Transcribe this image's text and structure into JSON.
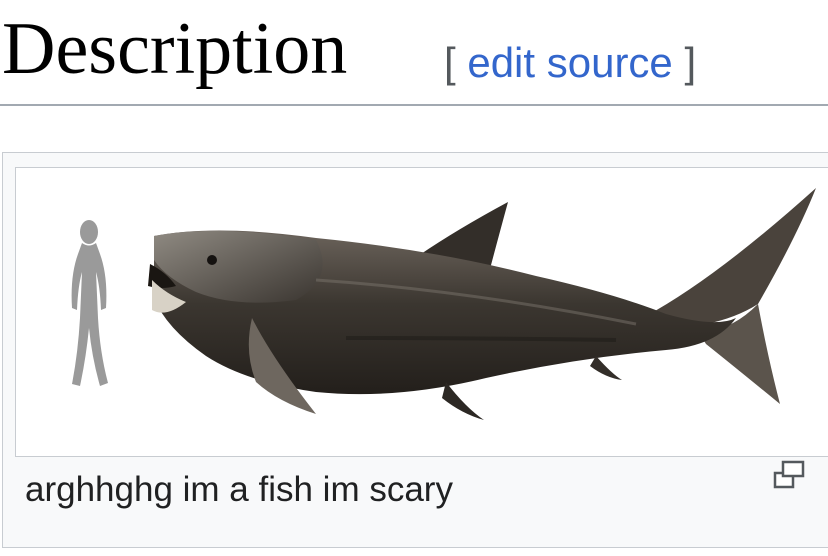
{
  "section": {
    "heading": "Description",
    "edit_open_bracket": "[",
    "edit_link": "edit source",
    "edit_close_bracket": "]"
  },
  "figure": {
    "caption": "arghhghg im a fish im scary",
    "enlarge_icon": "magnify-clip-icon",
    "image_subject": "dunkleosteus-fish-with-human-scale-silhouette"
  },
  "colors": {
    "link": "#3366cc",
    "heading_rule": "#a2a9b1",
    "thumb_border": "#c8ccd1",
    "thumb_background": "#f8f9fa"
  }
}
